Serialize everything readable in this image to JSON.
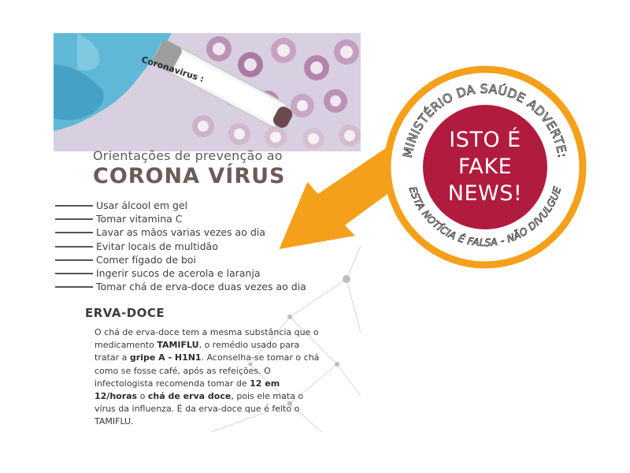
{
  "flyer": {
    "photo_label": "Coronavirus :",
    "heading_pre": "Orientações de prevenção ao",
    "heading_main": "CORONA VÍRUS",
    "tips": [
      "Usar álcool em gel",
      "Tomar vitamina C",
      "Lavar as mãos varias vezes ao dia",
      "Evitar locais de multidão",
      "Comer fígado de boi",
      "Ingerir sucos de acerola e laranja",
      "Tomar chá de erva-doce duas vezes ao dia"
    ],
    "section_title": "ERVA-DOCE",
    "paragraph": {
      "p1": "O chá de erva-doce tem a mesma substância que o medicamento ",
      "b1": "TAMIFLU",
      "p2": ", o remédio usado para tratar a ",
      "b2": "gripe A - H1N1",
      "p3": ". Aconselha-se tomar o chá como se fosse café, após as  refeições. O infectologista recomenda tomar de ",
      "b3": "12 em 12/horas",
      "p4": " o ",
      "b4": "chá de erva doce",
      "p5": ", pois ele mata o vírus da influenza. É da erva-doce que é feito  o TAMIFLU."
    }
  },
  "stamp": {
    "top_arc": "MINISTÉRIO DA SAÚDE ADVERTE:",
    "bottom_arc": "ESTA NOTÍCIA É FALSA - NÃO DIVULGUE",
    "center_lines": [
      "ISTO É",
      "FAKE",
      "NEWS!"
    ]
  },
  "colors": {
    "stamp_ring": "#f5a01a",
    "stamp_center": "#b11b3e",
    "arrow": "#f5a01a",
    "heading": "#6d5a57"
  },
  "icons": {
    "arrow": "left-pointing-arrow",
    "photo": "gloved-hand-holding-test-tube"
  }
}
